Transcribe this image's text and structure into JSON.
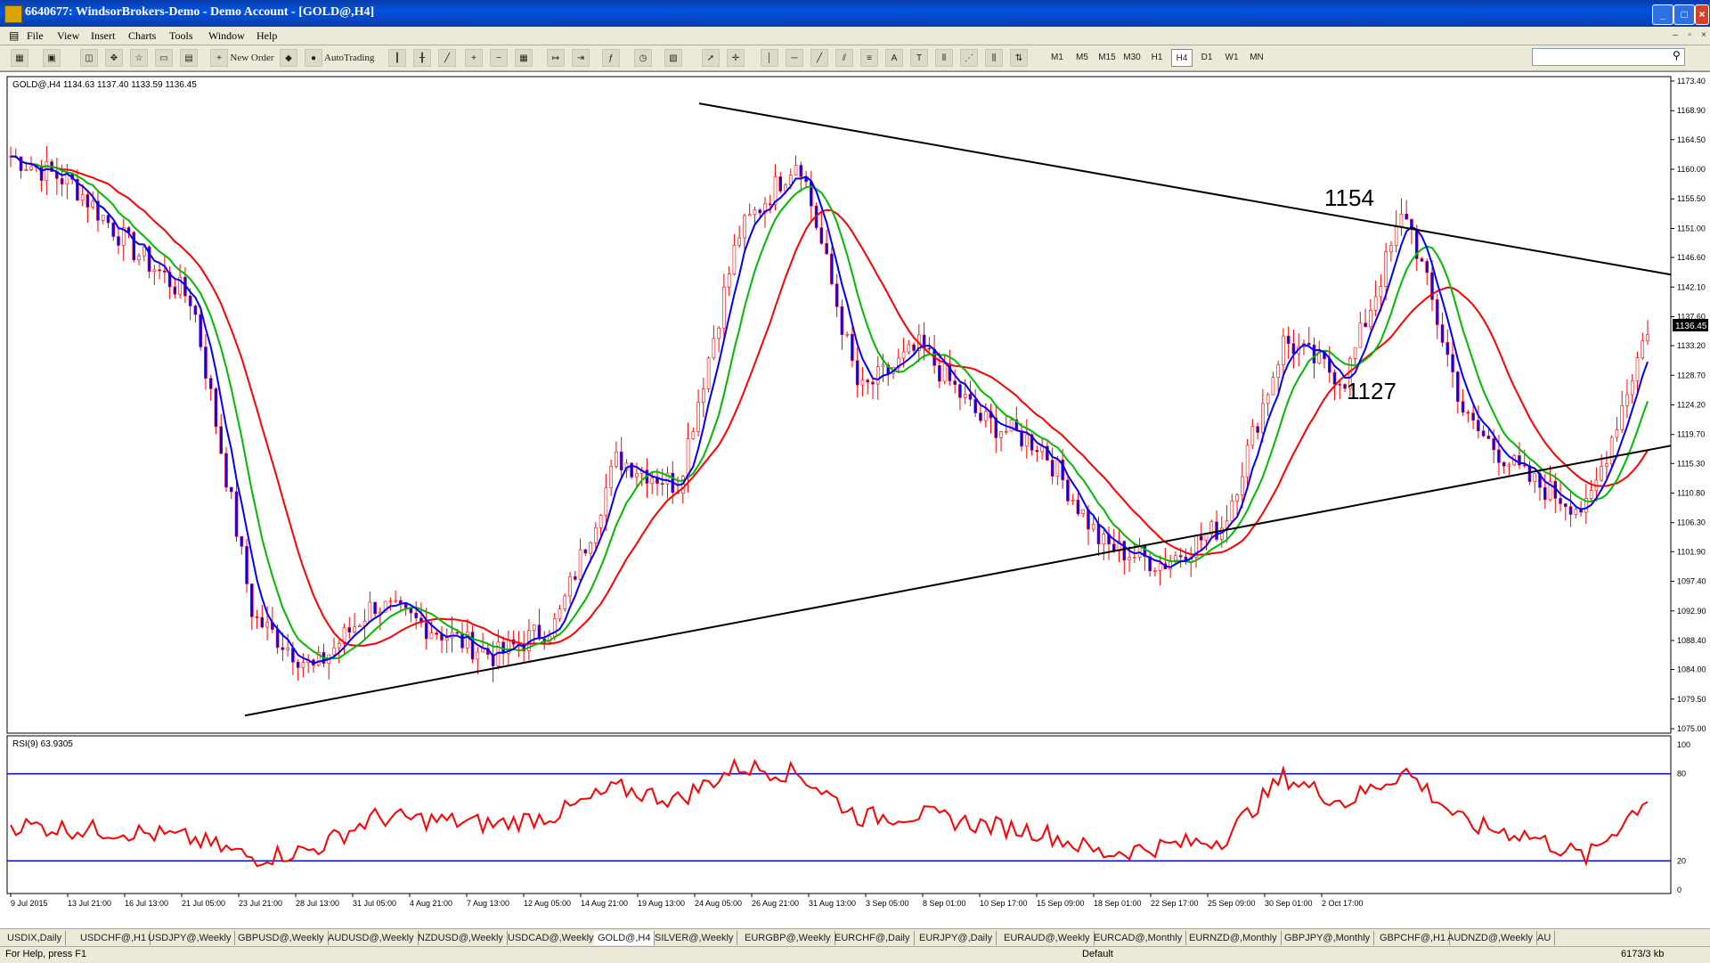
{
  "window": {
    "title": "6640677: WindsorBrokers-Demo - Demo Account - [GOLD@,H4]"
  },
  "menu": [
    "File",
    "View",
    "Insert",
    "Charts",
    "Tools",
    "Window",
    "Help"
  ],
  "toolbar": {
    "new_order": "New Order",
    "autotrading": "AutoTrading",
    "timeframes": [
      "M1",
      "M5",
      "M15",
      "M30",
      "H1",
      "H4",
      "D1",
      "W1",
      "MN"
    ],
    "active_timeframe": "H4"
  },
  "chart": {
    "header": "GOLD@,H4  1134.63 1137.40 1133.59 1136.45",
    "current_price": "1136.45",
    "annotations": [
      "1154",
      "1127"
    ],
    "price_labels": [
      "1173.40",
      "1168.90",
      "1164.50",
      "1160.00",
      "1155.50",
      "1151.00",
      "1146.60",
      "1142.10",
      "1137.60",
      "1133.20",
      "1128.70",
      "1124.20",
      "1119.70",
      "1115.30",
      "1110.80",
      "1106.30",
      "1101.90",
      "1097.40",
      "1092.90",
      "1088.40",
      "1084.00",
      "1079.50",
      "1075.00"
    ],
    "time_labels": [
      "9 Jul 2015",
      "13 Jul 21:00",
      "16 Jul 13:00",
      "21 Jul 05:00",
      "23 Jul 21:00",
      "28 Jul 13:00",
      "31 Jul 05:00",
      "4 Aug 21:00",
      "7 Aug 13:00",
      "12 Aug 05:00",
      "14 Aug 21:00",
      "19 Aug 13:00",
      "24 Aug 05:00",
      "26 Aug 21:00",
      "31 Aug 13:00",
      "3 Sep 05:00",
      "8 Sep 01:00",
      "10 Sep 17:00",
      "15 Sep 09:00",
      "18 Sep 01:00",
      "22 Sep 17:00",
      "25 Sep 09:00",
      "30 Sep 01:00",
      "2 Oct 17:00"
    ],
    "rsi_header": "RSI(9) 63.9305",
    "rsi_labels": [
      "100",
      "80",
      "20",
      "0"
    ]
  },
  "chart_data": {
    "type": "candlestick",
    "symbol": "GOLD@",
    "timeframe": "H4",
    "ohlc_last": {
      "open": 1134.63,
      "high": 1137.4,
      "low": 1133.59,
      "close": 1136.45
    },
    "ylim": [
      1075.0,
      1173.4
    ],
    "x": [
      "9 Jul 2015",
      "13 Jul 21:00",
      "16 Jul 13:00",
      "21 Jul 05:00",
      "23 Jul 21:00",
      "28 Jul 13:00",
      "31 Jul 05:00",
      "4 Aug 21:00",
      "7 Aug 13:00",
      "12 Aug 05:00",
      "14 Aug 21:00",
      "19 Aug 13:00",
      "24 Aug 05:00",
      "26 Aug 21:00",
      "31 Aug 13:00",
      "3 Sep 05:00",
      "8 Sep 01:00",
      "10 Sep 17:00",
      "15 Sep 09:00",
      "18 Sep 01:00",
      "22 Sep 17:00",
      "25 Sep 09:00",
      "30 Sep 01:00",
      "2 Oct 17:00"
    ],
    "price": [
      1162,
      1158,
      1148,
      1140,
      1092,
      1084,
      1094,
      1090,
      1086,
      1091,
      1116,
      1112,
      1150,
      1162,
      1126,
      1133,
      1122,
      1118,
      1103,
      1100,
      1106,
      1134,
      1128,
      1154,
      1122,
      1113,
      1108,
      1136
    ],
    "rsi": [
      45,
      42,
      40,
      35,
      22,
      28,
      50,
      48,
      45,
      52,
      70,
      62,
      85,
      80,
      50,
      52,
      45,
      40,
      25,
      30,
      35,
      78,
      60,
      82,
      45,
      38,
      22,
      64
    ],
    "rsi_levels": [
      80,
      20
    ],
    "trendlines": [
      {
        "from": [
          "23 Jul 2015",
          1077
        ],
        "to": [
          "8 Oct 2015",
          1118
        ]
      },
      {
        "from": [
          "24 Aug 2015",
          1170
        ],
        "to": [
          "8 Oct 2015",
          1144
        ]
      }
    ],
    "moving_averages": [
      "blue",
      "green",
      "red"
    ],
    "annotations": [
      "1154",
      "1127"
    ],
    "colors": {
      "candles": "#ff0000",
      "ma_fast": "#0000ff",
      "ma_mid": "#00bb00",
      "ma_slow": "#ff0000",
      "trendline": "#000000",
      "rsi": "#ff0000",
      "rsi_levels": "#0000c0"
    }
  },
  "tabs": [
    "USDIX,Daily",
    "USDCHF@,H1",
    "USDJPY@,Weekly",
    "GBPUSD@,Weekly",
    "AUDUSD@,Weekly",
    "NZDUSD@,Weekly",
    "USDCAD@,Weekly",
    "GOLD@,H4",
    "SILVER@,Weekly",
    "EURGBP@,Weekly",
    "EURCHF@,Daily",
    "EURJPY@,Daily",
    "EURAUD@,Weekly",
    "EURCAD@,Monthly",
    "EURNZD@,Monthly",
    "GBPJPY@,Monthly",
    "GBPCHF@,H1",
    "AUDNZD@,Weekly",
    "AU"
  ],
  "active_tab": "GOLD@,H4",
  "status": {
    "help": "For Help, press F1",
    "profile": "Default",
    "traffic": "6173/3 kb"
  }
}
